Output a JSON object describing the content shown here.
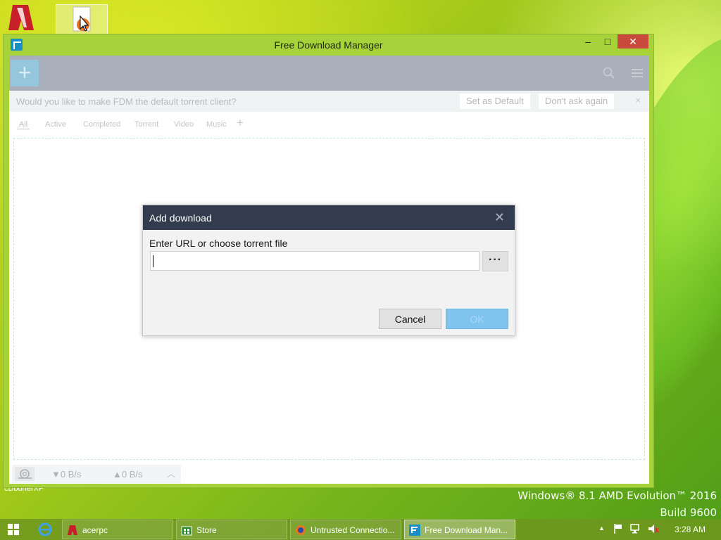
{
  "desktop": {
    "watermark_line1": "Windows® 8.1 AMD Evolution™ 2016",
    "watermark_line2": "Build 9600",
    "partial_label": "cDbunerXP"
  },
  "window": {
    "title": "Free Download Manager",
    "minimize": "–",
    "maximize": "□",
    "close": "✕"
  },
  "toolbar": {
    "add_label": "+",
    "search_icon": "search-icon",
    "menu_icon": "menu-icon"
  },
  "notification": {
    "text": "Would you like to make FDM the default torrent client?",
    "set_default": "Set as Default",
    "dont_ask": "Don't ask again",
    "close": "×"
  },
  "tabs": [
    {
      "label": "All"
    },
    {
      "label": "Active"
    },
    {
      "label": "Completed"
    },
    {
      "label": "Torrent"
    },
    {
      "label": "Video"
    },
    {
      "label": "Music"
    }
  ],
  "tab_add": "+",
  "statusbar": {
    "download_speed": "▼0 B/s",
    "upload_speed": "▲0 B/s",
    "chevron": "︿"
  },
  "dialog": {
    "title": "Add download",
    "close": "✕",
    "label": "Enter URL or choose torrent file",
    "url_value": "",
    "browse": "···",
    "cancel": "Cancel",
    "ok": "OK"
  },
  "taskbar": {
    "tasks": [
      {
        "label": "acerpc"
      },
      {
        "label": "Store"
      },
      {
        "label": "Untrusted Connectio..."
      },
      {
        "label": "Free Download Man..."
      }
    ],
    "clock": "3:28 AM",
    "tray_up": "▲"
  },
  "colors": {
    "dialog_header": "#323c4e",
    "ok_button": "#7ec4ef",
    "window_frame": "#a8d23a"
  }
}
